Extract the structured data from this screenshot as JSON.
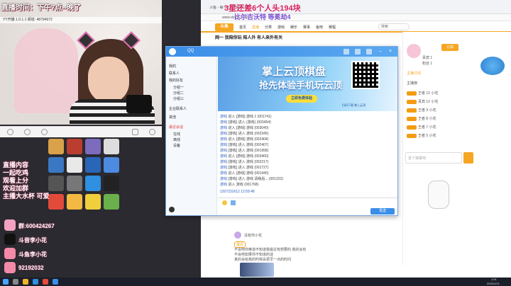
{
  "overlay": {
    "stream_time": "直播时间：下午7点--晚了",
    "yy_bar": "YY开播  1.0.1.1  频道: 48794972",
    "goal_title": "3星还差6个人头194块",
    "goal_sub": "比尔吉沃特  等冕劫4",
    "side_text_lines": [
      "直播内容",
      "一起吃鸡",
      "观看上分",
      "欢迎加群",
      "主播大水杯 可爱"
    ],
    "contacts": [
      {
        "label": "群:600424267",
        "icon": "group-icon"
      },
      {
        "label": "斗音李小花",
        "icon": "tiktok-icon"
      },
      {
        "label": "斗鱼李小花",
        "icon": "pig-icon"
      },
      {
        "label": "92192032",
        "icon": "pig-icon"
      }
    ]
  },
  "desktop_icons": [
    "pubg",
    "app2",
    "app3",
    "notepad",
    "app5",
    "app6",
    "app7",
    "app8",
    "app9",
    "app10",
    "app11",
    "app12",
    "edge",
    "app14",
    "app15",
    "app16",
    "app17",
    "app18",
    "app19",
    "app20"
  ],
  "browser": {
    "tab_label": "斗鱼 - 每个人的直播平台",
    "url": "www.douyu.com/",
    "site_logo": "斗鱼",
    "nav": [
      "首页",
      "直播",
      "分类",
      "游戏",
      "娱乐",
      "赛事",
      "鱼吧",
      "赛程"
    ],
    "search_placeholder": "搜索",
    "stream_title": "网一 我陪你玩 陪人外 有人来外有关",
    "right_panel": [
      "贵宾 1",
      "粉丝 1",
      "主播订阅",
      "主播榜",
      "每日贡献榜",
      "王者 12 小花",
      "贵宾 12 小花",
      "王者 9 小花",
      "王者 8 小花",
      "王者 7 小花",
      "王者 5 小花"
    ],
    "right_buttons": [
      "订阅",
      "主播"
    ],
    "lower_user": "没有你小花",
    "lower_tag": "最近",
    "lower_lines": [
      "不会吧你难道不知道我最近有想要的 真的会有",
      "不会吧如果你不知道的话",
      "真的会给我的时候会更早一点的时间"
    ],
    "chat_placeholder": "发个弹幕吧"
  },
  "qq": {
    "title": "QQ",
    "side_items": [
      "我的",
      "联系人",
      "我的好友",
      "分组一",
      "分组二",
      "分组三",
      "企业联系人",
      "其他",
      "最近会话",
      "在线",
      "离线",
      "设备"
    ],
    "ad": {
      "title": "掌上云顶棋盘",
      "subtitle": "抢先体验手机玩云顶",
      "button": "立即免费体验",
      "qr_caption": "扫码下载 掌上云顶"
    },
    "messages": [
      {
        "user": "游戏",
        "text": "进入 [游戏] 游戏  1 (001741)"
      },
      {
        "user": "游戏",
        "text": "[游戏]  进入 (游戏)   (003454)"
      },
      {
        "user": "游戏",
        "text": "进入 [游戏]  游戏    (003040)"
      },
      {
        "user": "游戏",
        "text": "[游戏]  进入  游戏    (002345)"
      },
      {
        "user": "游戏",
        "text": "进入 [游戏] 游戏     (002404)"
      },
      {
        "user": "游戏",
        "text": "[游戏] 进入   游戏   (002407)"
      },
      {
        "user": "游戏",
        "text": "[游戏] 进入 游戏     (001958)"
      },
      {
        "user": "游戏",
        "text": "进入 [游戏] 游戏     (003460)"
      },
      {
        "user": "游戏",
        "text": "[游戏] 进入 游戏     (002217)"
      },
      {
        "user": "游戏",
        "text": "[游戏] 进入 游戏     (001727)"
      },
      {
        "user": "游戏",
        "text": "进入 [游戏] 游戏     (001440)"
      },
      {
        "user": "游戏",
        "text": "[游戏] 进入 游戏 请稍后...   (001322)"
      },
      {
        "user": "游戏",
        "text": "进入 游戏     (001768)"
      }
    ],
    "status_line": "1207231612 12:59:48",
    "send_label": "发送"
  },
  "taskbar": {
    "time": "1:01",
    "date": "2023/1/21"
  },
  "colors": {
    "qq_blue": "#3b8ee8",
    "douyu_orange": "#f5a623",
    "goal_pink": "#d81e5b"
  }
}
